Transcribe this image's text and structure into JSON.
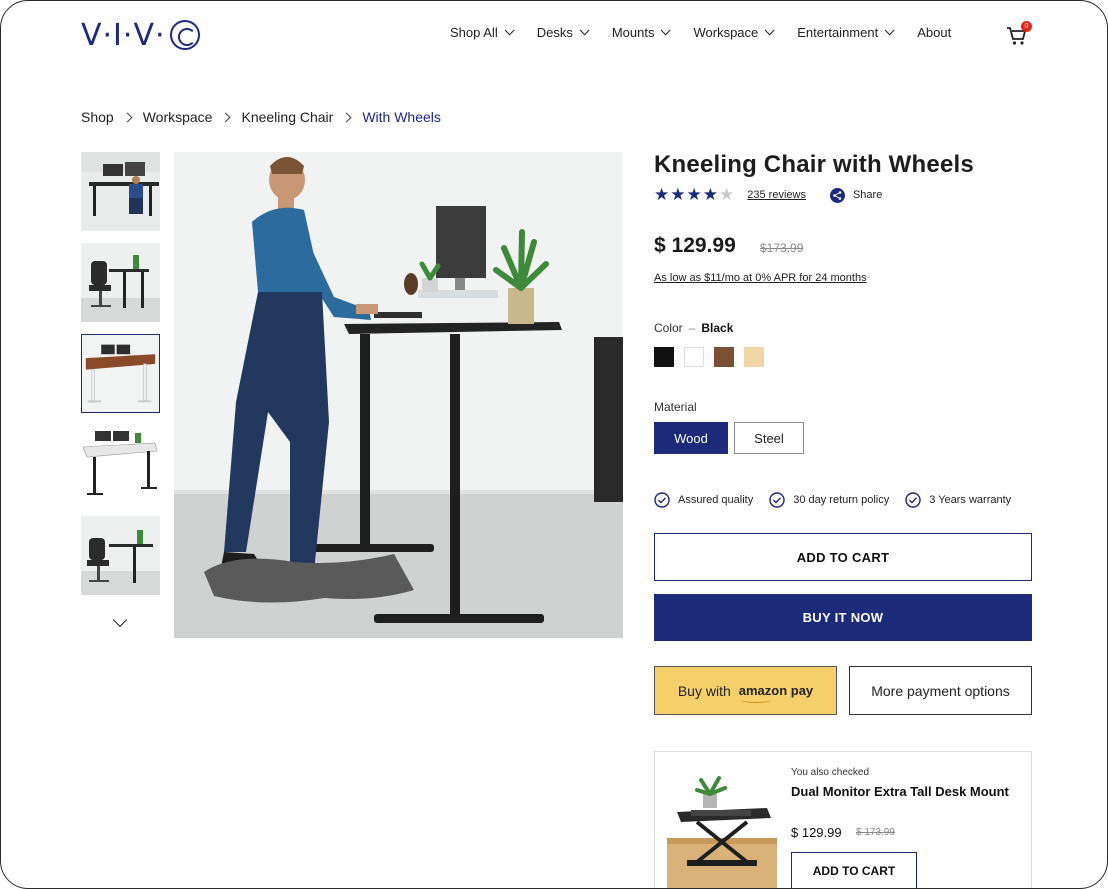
{
  "brand": {
    "logo_text": "V·I·V·"
  },
  "nav": {
    "items": [
      {
        "label": "Shop All"
      },
      {
        "label": "Desks"
      },
      {
        "label": "Mounts"
      },
      {
        "label": "Workspace"
      },
      {
        "label": "Entertainment"
      }
    ],
    "about_label": "About",
    "cart_count": "0"
  },
  "breadcrumb": [
    "Shop",
    "Workspace",
    "Kneeling Chair",
    "With Wheels"
  ],
  "product": {
    "title": "Kneeling Chair with Wheels",
    "rating": 4,
    "reviews_label": "235 reviews",
    "share_label": "Share",
    "price": "$ 129.99",
    "old_price": "$173.99",
    "financing": "As low as $11/mo at 0% APR for 24 months",
    "color_label": "Color",
    "color_selected": "Black",
    "colors": [
      "#111111",
      "#ffffff",
      "#7a4f34",
      "#f1d7a8"
    ],
    "material_label": "Material",
    "materials": [
      "Wood",
      "Steel"
    ],
    "selected_material": "Wood",
    "features": [
      "Assured quality",
      "30 day return policy",
      "3 Years warranty"
    ],
    "add_to_cart": "ADD TO CART",
    "buy_now": "BUY IT NOW",
    "amazon_prefix": "Buy with",
    "amazon_brand": "amazon pay",
    "more_payment": "More payment options"
  },
  "recommendation": {
    "also_label": "You also checked",
    "title": "Dual Monitor Extra Tall Desk Mount",
    "price": "$ 129.99",
    "old_price": "$ 173.99",
    "add_to_cart": "ADD TO CART"
  },
  "accent_color": "#1c2a7a"
}
